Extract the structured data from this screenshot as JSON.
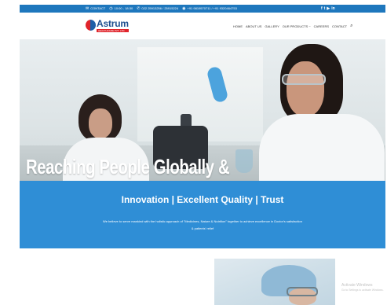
{
  "topbar": {
    "contact_label": "CONTACT",
    "hours": "10:00 - 18:30",
    "phone": "022 25913256 / 25915224",
    "mobile": "+91 9819570711 / +91 9320464753",
    "social": [
      "f",
      "t",
      "▶",
      "in"
    ]
  },
  "logo": {
    "name": "Astrum",
    "subtitle": "HEALTHCARE PVT. LTD."
  },
  "nav": {
    "items": [
      "HOME",
      "ABOUT US",
      "GALLERY",
      "OUR PRODUCTS ~",
      "CAREERS",
      "CONTACT"
    ]
  },
  "hero": {
    "title": "Reaching People Globally &"
  },
  "band": {
    "title": "Innovation | Excellent Quality | Trust",
    "text_line1": "We believe to serve mankind with the holistic approach of \"Medicines, Nature & Nutrition\" together to achieve excellence in Doctor's satisfaction",
    "text_line2": "& patients' relief"
  },
  "watermark": {
    "line1": "Activate Windows",
    "line2": "Go to Settings to activate Windows."
  },
  "colors": {
    "primary_blue": "#1e77bd",
    "band_blue": "#2f8ed6",
    "logo_red": "#e0242b",
    "logo_blue": "#1e4f8f"
  }
}
